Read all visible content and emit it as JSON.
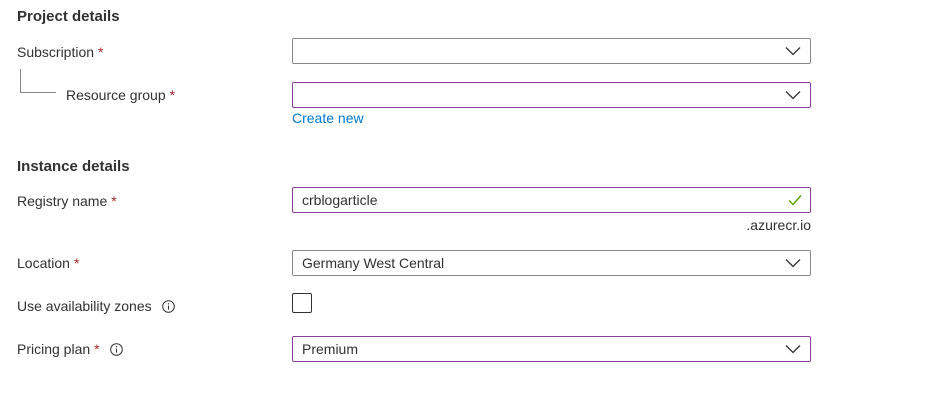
{
  "project_details": {
    "title": "Project details",
    "subscription": {
      "label": "Subscription",
      "required_mark": "*",
      "value": ""
    },
    "resource_group": {
      "label": "Resource group",
      "required_mark": "*",
      "value": "",
      "create_new_link": "Create new"
    }
  },
  "instance_details": {
    "title": "Instance details",
    "registry_name": {
      "label": "Registry name",
      "required_mark": "*",
      "value": "crblogarticle",
      "suffix": ".azurecr.io",
      "valid_icon": "checkmark-icon"
    },
    "location": {
      "label": "Location",
      "required_mark": "*",
      "value": "Germany West Central"
    },
    "availability_zones": {
      "label": "Use availability zones",
      "checked": false,
      "info_icon": "info-icon"
    },
    "pricing_plan": {
      "label": "Pricing plan",
      "required_mark": "*",
      "value": "Premium",
      "info_icon": "info-icon"
    }
  },
  "colors": {
    "text": "#323130",
    "required": "#a4262c",
    "link": "#0078d4",
    "border": "#8a8886",
    "focus_border": "#8a3e9e",
    "valid": "#57a300"
  }
}
